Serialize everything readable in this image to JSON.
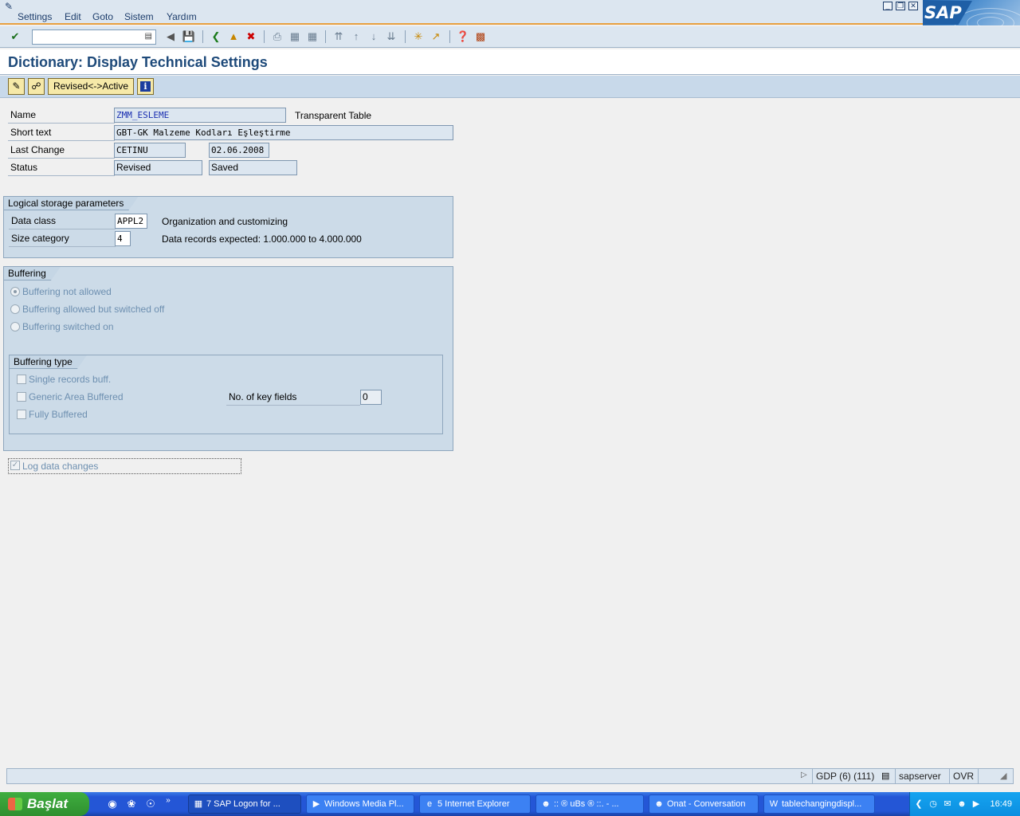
{
  "menu": {
    "items": [
      "Settings",
      "Edit",
      "Goto",
      "Sistem",
      "Yardım"
    ]
  },
  "toolbar": {
    "command_value": ""
  },
  "page": {
    "title": "Dictionary: Display Technical Settings"
  },
  "app_toolbar": {
    "revised_active_label": "Revised<->Active"
  },
  "header": {
    "name_label": "Name",
    "name_value": "ZMM_ESLEME",
    "table_type": "Transparent Table",
    "short_text_label": "Short text",
    "short_text_value": "GBT-GK Malzeme Kodları Eşleştirme",
    "last_change_label": "Last Change",
    "last_change_user": "CETINU",
    "last_change_date": "02.06.2008",
    "status_label": "Status",
    "status_value": "Revised",
    "status_saved": "Saved"
  },
  "logical_storage": {
    "title": "Logical storage parameters",
    "data_class_label": "Data class",
    "data_class_value": "APPL2",
    "data_class_desc": "Organization and customizing",
    "size_category_label": "Size category",
    "size_category_value": "4",
    "size_category_desc": "Data records expected: 1.000.000 to 4.000.000"
  },
  "buffering": {
    "title": "Buffering",
    "option_not_allowed": "Buffering not allowed",
    "option_switched_off": "Buffering allowed but switched off",
    "option_switched_on": "Buffering switched on",
    "selected": "Buffering not allowed"
  },
  "buffering_type": {
    "title": "Buffering type",
    "single_records": "Single records buff.",
    "generic_area": "Generic Area Buffered",
    "fully_buffered": "Fully Buffered",
    "key_fields_label": "No. of key fields",
    "key_fields_value": "0"
  },
  "log_changes": {
    "label": "Log data changes",
    "checked": true
  },
  "statusbar": {
    "system": "GDP (6) (111)",
    "server": "sapserver",
    "mode": "OVR"
  },
  "taskbar": {
    "start_label": "Başlat",
    "tasks": [
      "7 SAP Logon for ...",
      "Windows Media Pl...",
      "5 Internet Explorer",
      ":: ® uBs ® ::. - ...",
      "Onat - Conversation",
      "tablechangingdispl..."
    ],
    "clock": "16:49"
  },
  "colors": {
    "accent_orange": "#e8a040",
    "title_blue": "#1e4a7a",
    "group_bg": "#ccdbe8",
    "taskbar_blue": "#2456d6",
    "start_green": "#2f8f2f"
  }
}
